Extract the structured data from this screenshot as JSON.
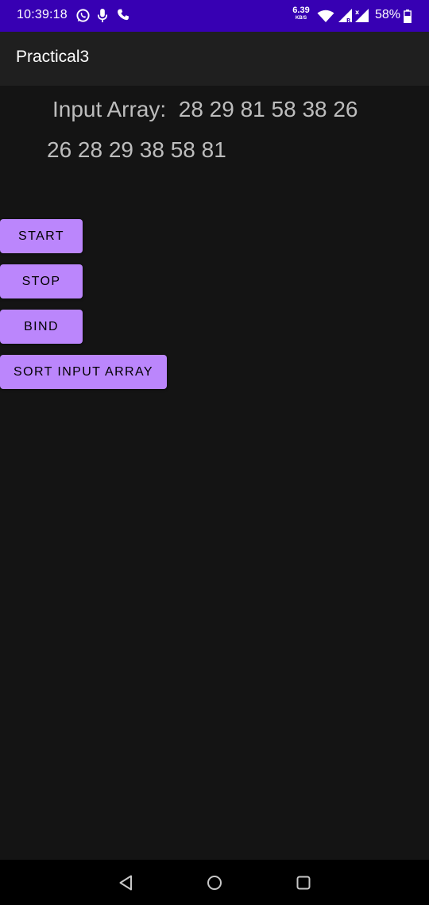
{
  "status_bar": {
    "time": "10:39:18",
    "net_speed_value": "6.39",
    "net_speed_unit": "KB/S",
    "battery": "58%",
    "background": "#3700b3",
    "icons": [
      "whatsapp-icon",
      "microphone-icon",
      "phone-icon",
      "wifi-icon",
      "signal-icon",
      "signal-x-icon",
      "battery-icon"
    ]
  },
  "app_bar": {
    "title": "Practical3"
  },
  "main": {
    "input_array_text": "Input Array:  28 29 81 58 38 26",
    "sorted_array_text": "26 28 29 38 58 81"
  },
  "buttons": {
    "start": "START",
    "stop": "STOP",
    "bind": "BIND",
    "sort": "SORT INPUT ARRAY",
    "color": "#bb86fc"
  },
  "nav_bar": {
    "icons": [
      "back-icon",
      "home-icon",
      "recents-icon"
    ]
  }
}
